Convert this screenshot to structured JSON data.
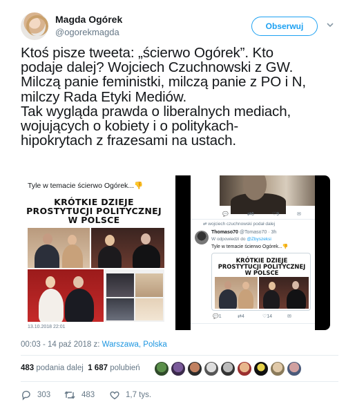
{
  "author": {
    "name": "Magda Ogórek",
    "handle": "@ogorekmagda"
  },
  "follow_label": "Obserwuj",
  "tweet_lines": [
    "Ktoś pisze tweeta: „ścierwo Ogórek”. Kto",
    "podaje dalej? Wojciech Czuchnowski z GW.",
    "Milczą panie feministki, milczą panie z PO i N,",
    "milczy Rada Etyki Mediów.",
    "Tak wygląda prawda o liberalnych mediach,",
    "wojujących o kobiety i o politykach-",
    "hipokrytach z frazesami na ustach."
  ],
  "media": {
    "left_caption": "Tyle w temacie ścierwo Ogórek...👎",
    "poster_title_lines": [
      "KRÓTKIE DZIEJE",
      "PROSTYTUCJI POLITYCZNEJ",
      "W POLSCE"
    ],
    "left_footer": "13.10.2018  22:01",
    "right": {
      "top_icons": [
        "💬",
        "⇄6",
        "♡9",
        "✉"
      ],
      "retweet_line": "⇄ wojciech czuchnowski podał dalej",
      "name": "Thomaso70",
      "meta": "@Tomaso70 · 3h",
      "reply": "W odpowiedzi do",
      "reply_to": "@Zbyszeksi",
      "text": "Tyle w temacie ścierwo Ogórek...👎",
      "poster_title_lines": [
        "KRÓTKIE DZIEJE",
        "PROSTYTUCJI POLITYCZNEJ",
        "W POLSCE"
      ],
      "bottom_icons": [
        "💬1",
        "⇄4",
        "♡14",
        "✉"
      ]
    }
  },
  "timestamp": "00:03 - 14 paź 2018 z: ",
  "location": "Warszawa, Polska",
  "stats": {
    "retweets": "483",
    "retweets_label": "podania dalej",
    "likes": "1 687",
    "likes_label": "polubień"
  },
  "actions": {
    "replies": "303",
    "retweets": "483",
    "likes": "1,7 tys."
  },
  "colors": {
    "accent": "#1da1f2",
    "secondary_text": "#657786",
    "text": "#14171a"
  }
}
